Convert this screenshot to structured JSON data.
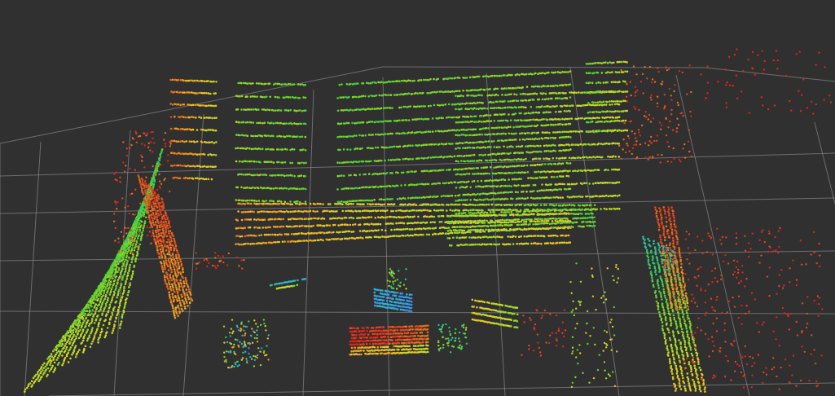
{
  "viewport": {
    "name": "3d-view",
    "background_color": "#303030",
    "grid_color": "#a0a0a6",
    "grid_visible": true
  },
  "point_cloud": {
    "color_scheme": "height-rainbow",
    "colors": [
      "#d9261c",
      "#e3441e",
      "#e86a1f",
      "#eb9a22",
      "#e8c225",
      "#c8d82a",
      "#93d52c",
      "#5fd02f",
      "#35c85a",
      "#2fbf9a",
      "#2db3cf",
      "#3b8fe6"
    ]
  }
}
